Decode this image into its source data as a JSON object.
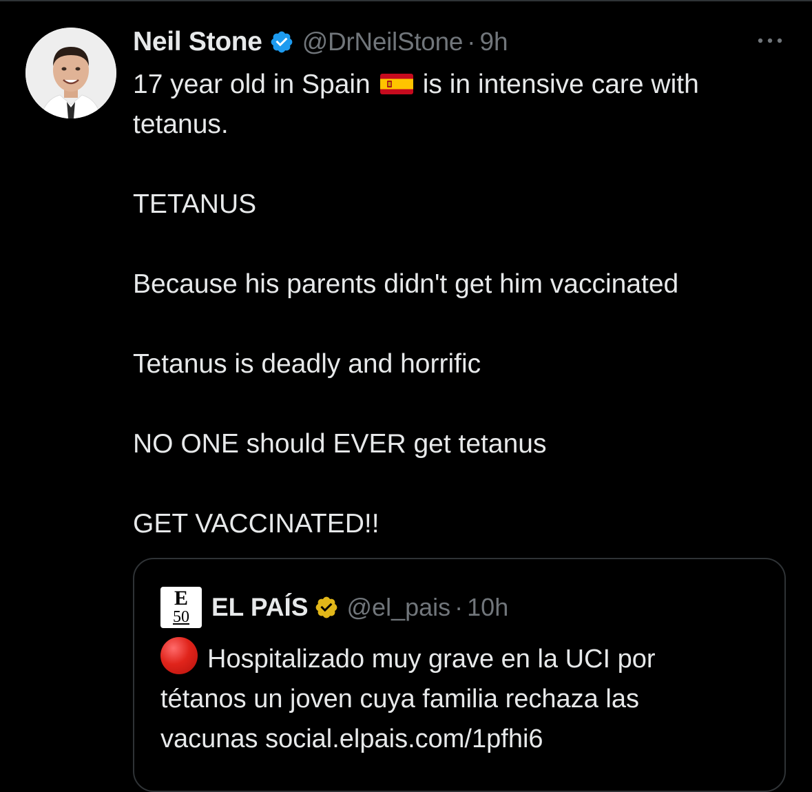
{
  "tweet": {
    "author_name": "Neil Stone",
    "author_handle": "@DrNeilStone",
    "separator": "·",
    "timestamp": "9h",
    "verified_badge_icon": "verified-check-icon",
    "verified_badge_color": "#1d9bf0",
    "avatar_icon": "profile-photo-avatar",
    "more_icon": "more-horizontal-icon",
    "text_lines": [
      "17 year old in Spain",
      "is in intensive care with",
      "tetanus.",
      "TETANUS",
      "Because his parents didn't get him vaccinated",
      "Tetanus is deadly and horrific",
      "NO ONE should EVER get tetanus",
      "GET VACCINATED!!"
    ],
    "flag_icon": "spain-flag-emoji"
  },
  "quote": {
    "logo_letter": "E",
    "logo_number": "50",
    "author_name": "EL PAÍS",
    "author_handle": "@el_pais",
    "separator": "·",
    "timestamp": "10h",
    "verified_badge_icon": "gold-verified-check-icon",
    "verified_badge_color": "#e2b719",
    "emoji_icon": "red-circle-emoji",
    "text_lines": [
      "Hospitalizado muy grave en la UCI por",
      "tétanos un joven cuya familia rechaza las",
      "vacunas social.elpais.com/1pfhi6"
    ]
  },
  "colors": {
    "background": "#000000",
    "primary_text": "#e7e9ea",
    "secondary_text": "#71767b",
    "border": "#2f3336"
  }
}
